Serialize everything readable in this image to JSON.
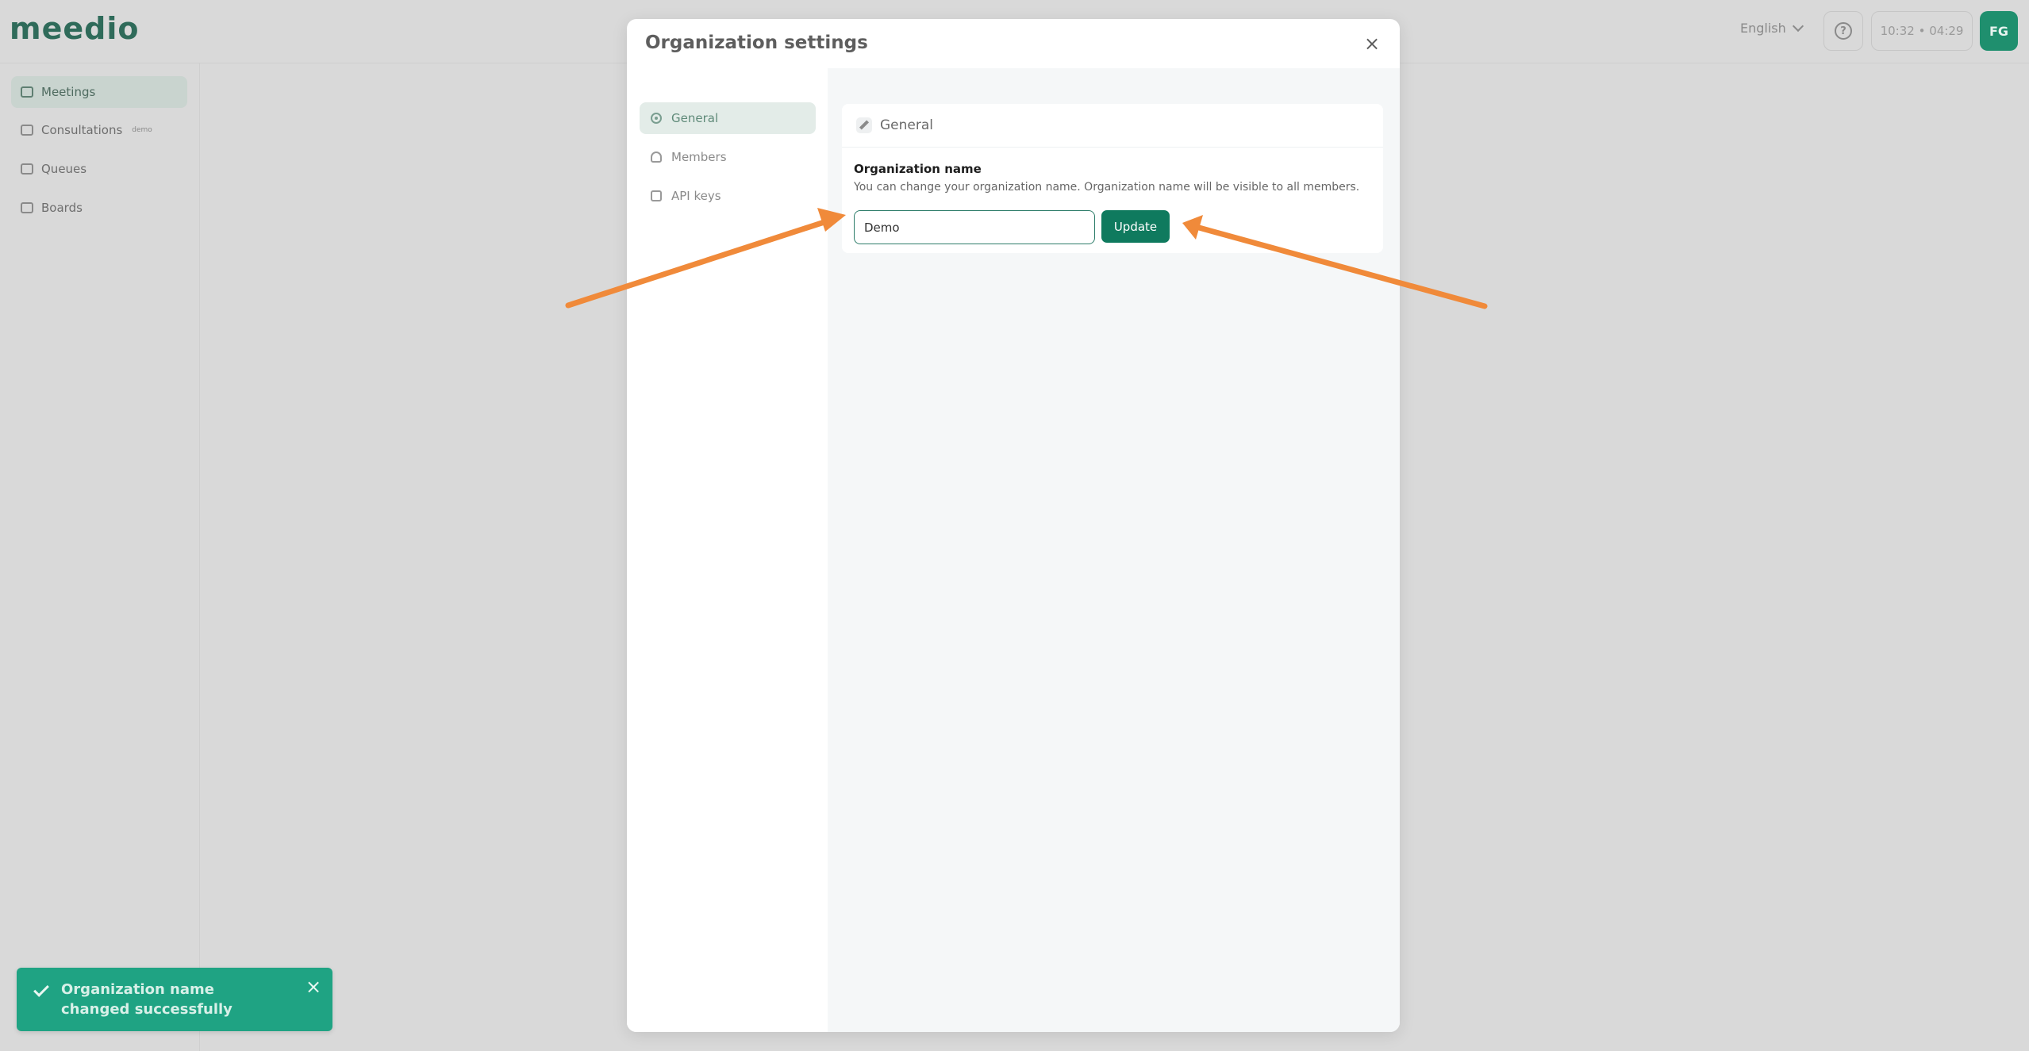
{
  "app": {
    "logo": "meedio",
    "language": "English",
    "clock": "10:32 • 04:29",
    "avatar_initials": "FG"
  },
  "sidebar": {
    "items": [
      {
        "label": "Meetings",
        "active": true,
        "icon": "video-icon"
      },
      {
        "label": "Consultations",
        "badge": "demo",
        "active": false,
        "icon": "video-plus-icon"
      },
      {
        "label": "Queues",
        "active": false,
        "icon": "queue-icon"
      },
      {
        "label": "Boards",
        "active": false,
        "icon": "grid-icon"
      }
    ]
  },
  "modal": {
    "title": "Organization settings",
    "close_label": "×",
    "nav": [
      {
        "label": "General",
        "active": true,
        "icon": "gear-icon"
      },
      {
        "label": "Members",
        "active": false,
        "icon": "users-icon"
      },
      {
        "label": "API keys",
        "active": false,
        "icon": "key-icon"
      }
    ],
    "card": {
      "title": "General",
      "field_label": "Organization name",
      "field_description": "You can change your organization name. Organization name will be visible to all members.",
      "input_value": "Demo",
      "update_label": "Update"
    }
  },
  "toast": {
    "message": "Organization name changed successfully",
    "close_label": "×"
  },
  "colors": {
    "accent": "#0f7a5e",
    "toast_bg": "#1fa383",
    "arrow": "#f08a3a",
    "overlay_bg": "#d9d9d9"
  }
}
